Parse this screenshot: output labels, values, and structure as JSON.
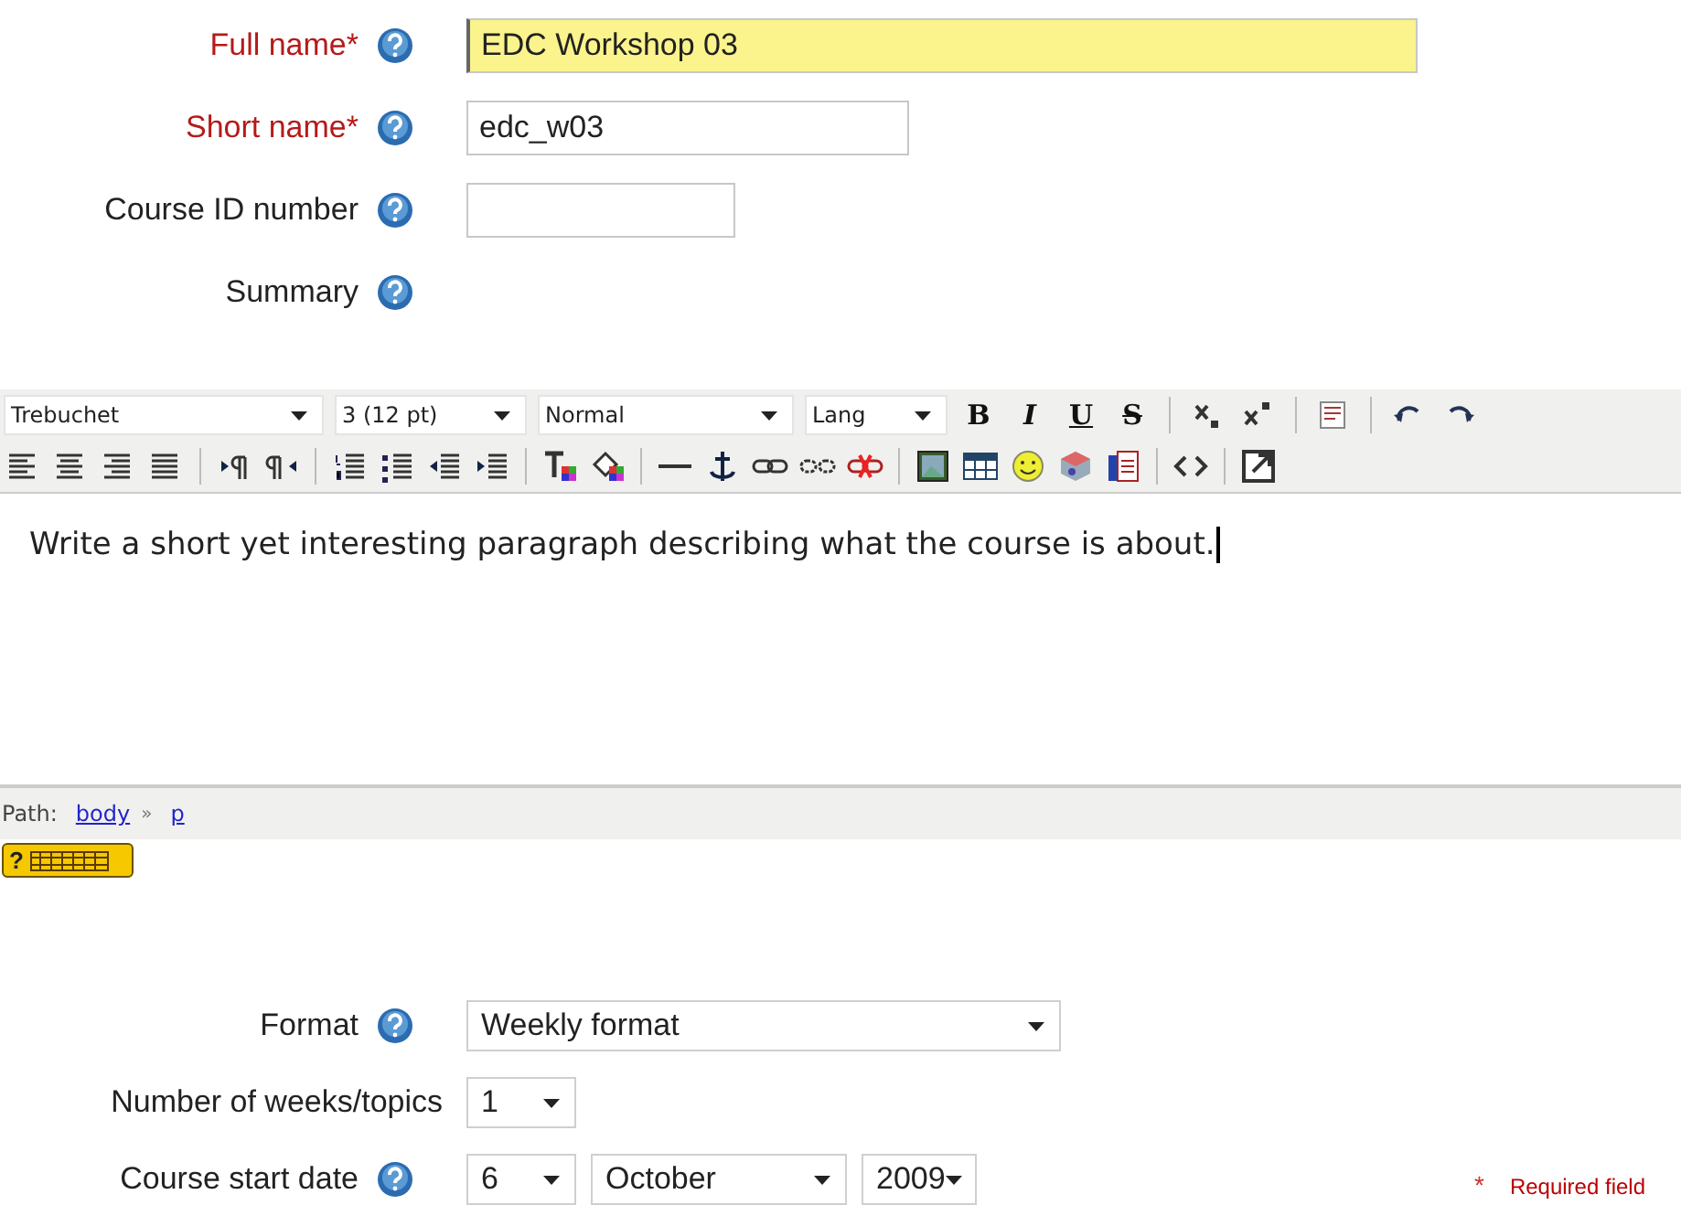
{
  "fields": [
    {
      "label": "Full name",
      "required_mark": "*",
      "help": true,
      "value": "EDC Workshop 03",
      "focused": true,
      "kind": "wide"
    },
    {
      "label": "Short name",
      "required_mark": "*",
      "help": true,
      "value": "edc_w03",
      "focused": false,
      "kind": "medium"
    },
    {
      "label": "Course ID number",
      "help": true,
      "focused": false,
      "kind": "small"
    },
    {
      "label": "Summary",
      "help": true,
      "kind": "none"
    }
  ],
  "editor": {
    "dropdowns": [
      {
        "value": "Trebuchet",
        "kind": "font"
      },
      {
        "value": "3 (12 pt)",
        "kind": "size"
      },
      {
        "value": "Normal",
        "kind": "format"
      },
      {
        "value": "Lang",
        "kind": "lang"
      }
    ],
    "style_buttons": [
      "B",
      "I",
      "U",
      "S"
    ],
    "content": "Write a short yet interesting paragraph describing what the course is about.",
    "path_label": "Path:",
    "path": [
      "body",
      "p"
    ],
    "path_separator": "»",
    "keyboard_badge": "?"
  },
  "settings": [
    {
      "label": "Format",
      "help": true,
      "selects": [
        {
          "value": "Weekly format",
          "kind": "wide"
        }
      ]
    },
    {
      "label": "Number of weeks/topics",
      "help": false,
      "selects": [
        {
          "value": "1",
          "kind": "small"
        }
      ]
    },
    {
      "label": "Course start date",
      "help": true,
      "selects": [
        {
          "value": "6",
          "kind": "small"
        },
        {
          "value": "October",
          "kind": "medium"
        },
        {
          "value": "2009",
          "kind": "year"
        }
      ]
    }
  ],
  "required_note": {
    "mark": "*",
    "text": "Required field"
  }
}
